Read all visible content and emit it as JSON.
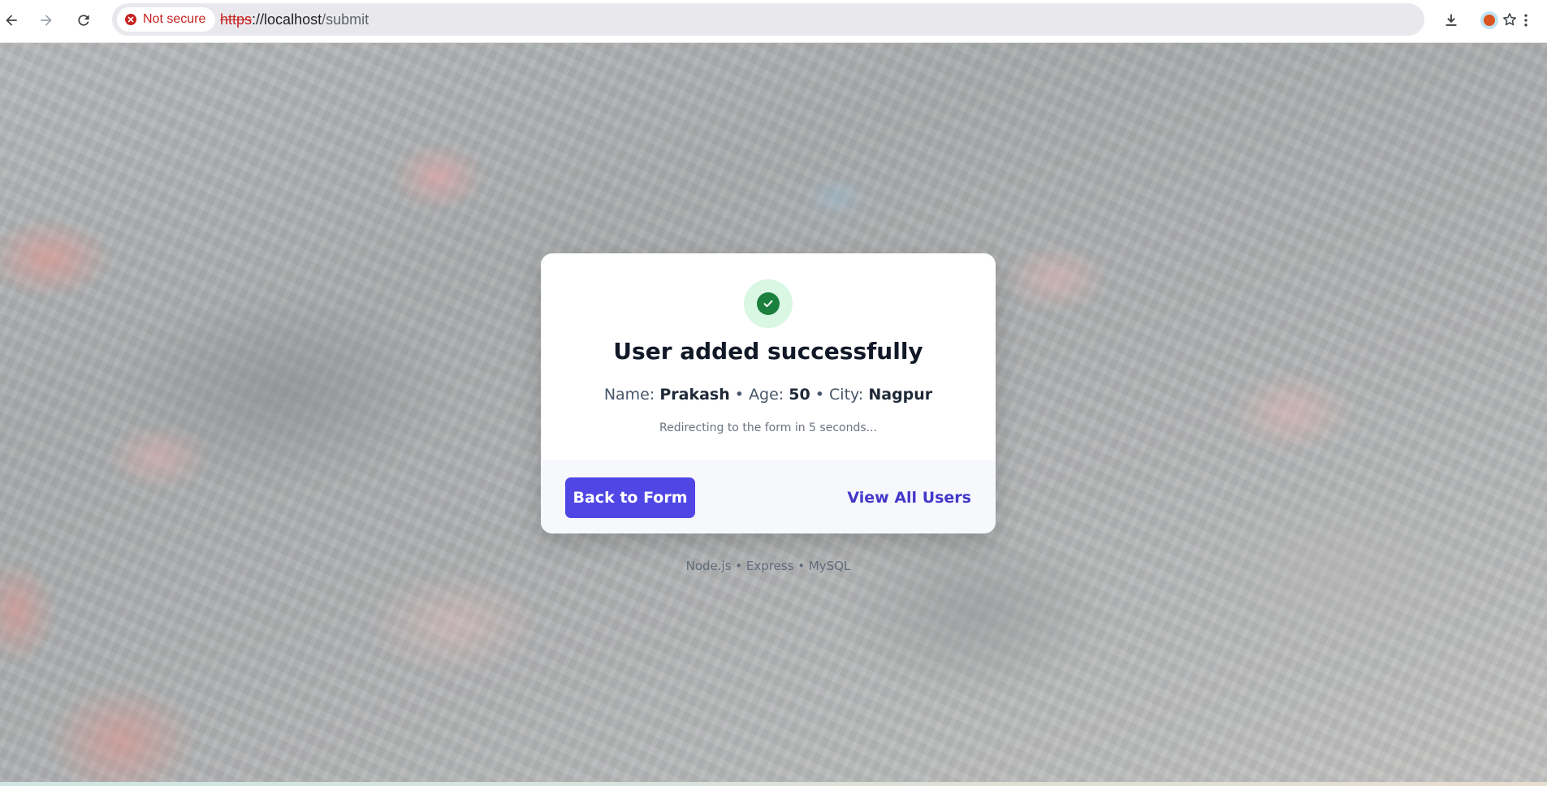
{
  "browser": {
    "security_label": "Not secure",
    "url_scheme": "https",
    "url_separator": "://",
    "url_host": "localhost",
    "url_path": "/submit",
    "icons": {
      "back": "arrow-left-icon",
      "forward": "arrow-right-icon",
      "reload": "reload-icon",
      "security": "error-circle-icon",
      "bookmark": "star-icon",
      "download": "download-icon",
      "profile": "avatar",
      "menu": "kebab-menu-icon"
    },
    "colors": {
      "warning": "#c5221f",
      "omnibox": "#e9e9ed"
    }
  },
  "card": {
    "title": "User added successfully",
    "details": {
      "name_label": "Name:",
      "name_value": "Prakash",
      "sep1": "•",
      "age_label": "Age:",
      "age_value": "50",
      "sep2": "•",
      "city_label": "City:",
      "city_value": "Nagpur"
    },
    "redirect_note": "Redirecting to the form in 5 seconds...",
    "back_button_label": "Back to Form",
    "view_users_label": "View All Users",
    "colors": {
      "primary": "#4f46e5",
      "success": "#1b7f3d",
      "success_bg": "#d9f7e3"
    }
  },
  "footer": {
    "tech_stack": "Node.js • Express • MySQL"
  }
}
